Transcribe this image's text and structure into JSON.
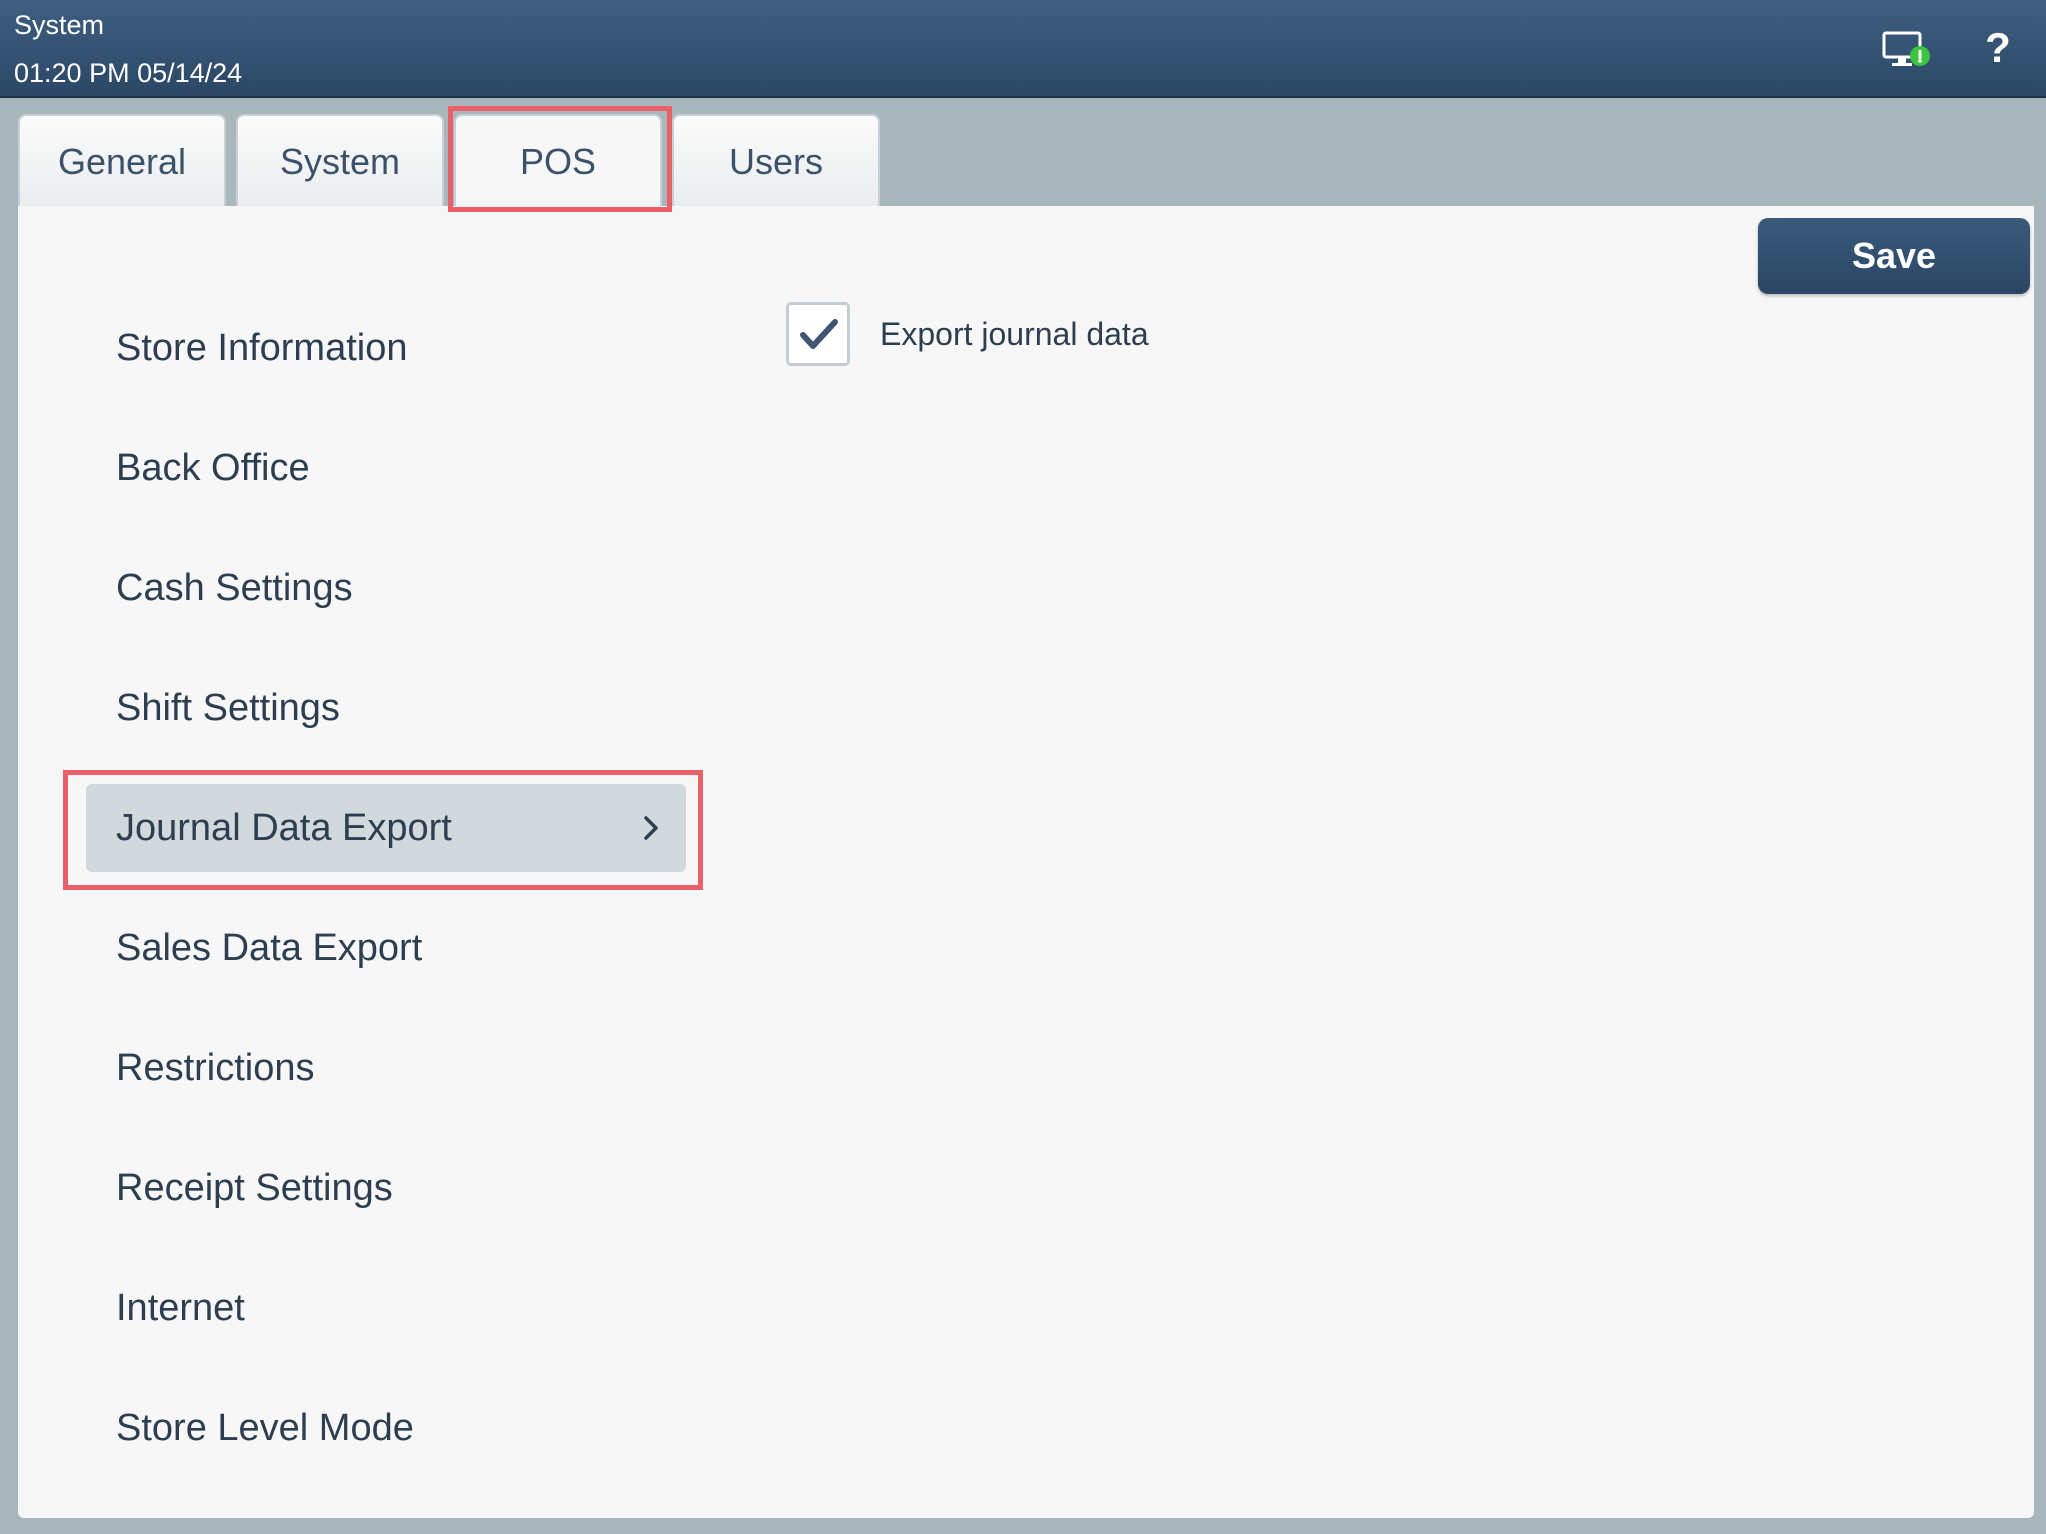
{
  "header": {
    "title": "System",
    "datetime": "01:20 PM 05/14/24",
    "icons": [
      "monitor-status-icon",
      "help-icon"
    ],
    "help_glyph": "?"
  },
  "tabs": [
    {
      "label": "General",
      "active": false
    },
    {
      "label": "System",
      "active": false
    },
    {
      "label": "POS",
      "active": true
    },
    {
      "label": "Users",
      "active": false
    }
  ],
  "toolbar": {
    "save_label": "Save"
  },
  "sidebar": {
    "items": [
      {
        "label": "Store Information"
      },
      {
        "label": "Back Office"
      },
      {
        "label": "Cash Settings"
      },
      {
        "label": "Shift Settings"
      },
      {
        "label": "Journal Data Export",
        "selected": true
      },
      {
        "label": "Sales Data Export"
      },
      {
        "label": "Restrictions"
      },
      {
        "label": "Receipt Settings"
      },
      {
        "label": "Internet"
      },
      {
        "label": "Store Level Mode"
      }
    ]
  },
  "content": {
    "export_checkbox": {
      "label": "Export journal data",
      "checked": true
    }
  },
  "colors": {
    "header_bg": "#34506f",
    "accent_highlight": "#e9606a",
    "selected_item_bg": "#d2d9dd",
    "status_green": "#3cc43c"
  }
}
